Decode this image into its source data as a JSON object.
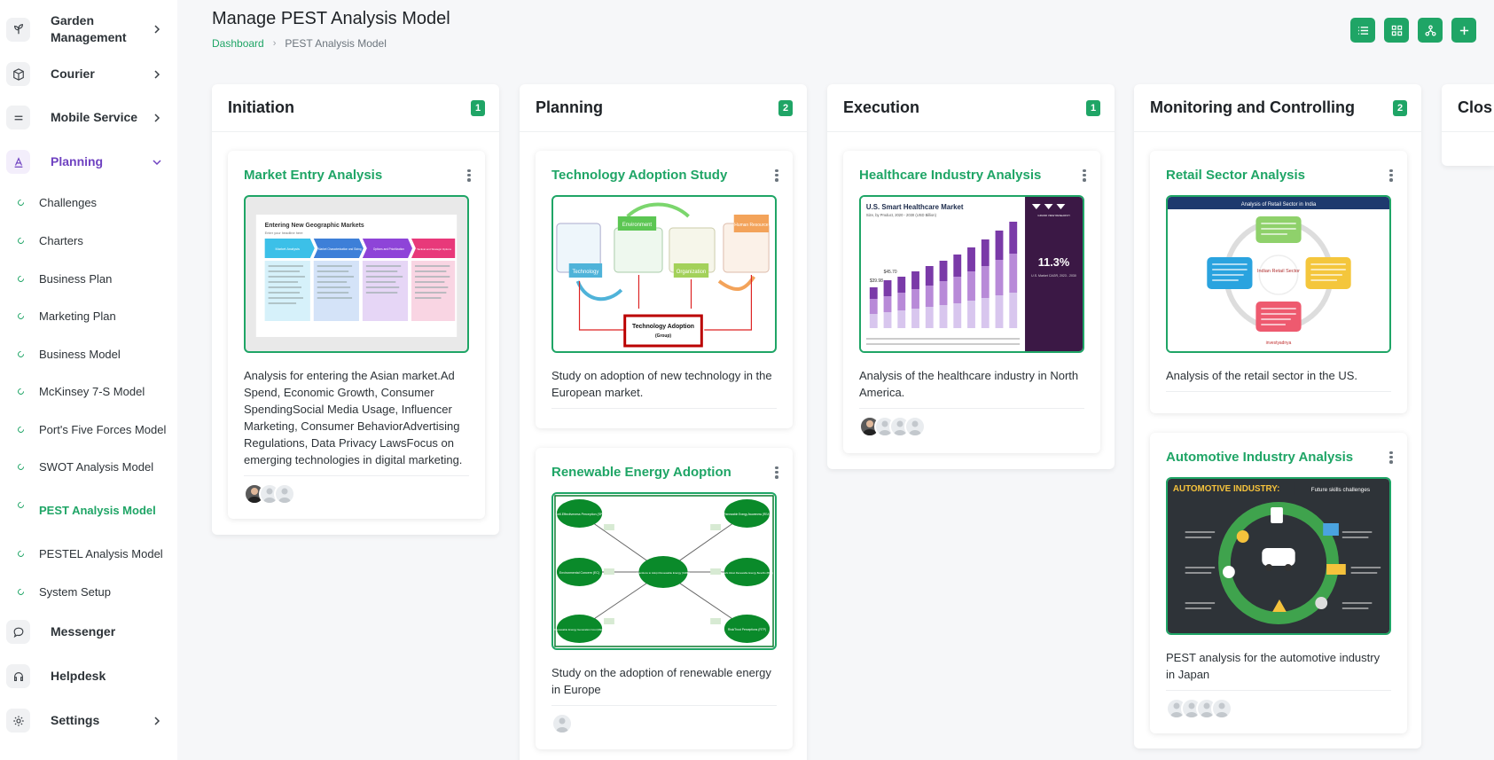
{
  "sidebar": {
    "items": [
      {
        "label": "Garden Management",
        "icon": "plant-icon"
      },
      {
        "label": "Courier",
        "icon": "box-icon"
      },
      {
        "label": "Mobile Service",
        "icon": "menu-icon"
      },
      {
        "label": "Planning",
        "icon": "planning-icon"
      },
      {
        "label": "Messenger",
        "icon": "chat-icon"
      },
      {
        "label": "Helpdesk",
        "icon": "headset-icon"
      },
      {
        "label": "Settings",
        "icon": "gear-icon"
      }
    ],
    "sub_items": [
      "Challenges",
      "Charters",
      "Business Plan",
      "Marketing Plan",
      "Business Model",
      "McKinsey 7-S Model",
      "Port's Five Forces Model",
      "SWOT Analysis Model",
      "PEST Analysis Model",
      "PESTEL Analysis Model",
      "System Setup"
    ]
  },
  "header": {
    "title": "Manage PEST Analysis Model",
    "breadcrumb": {
      "home": "Dashboard",
      "current": "PEST Analysis Model"
    },
    "toolbar": [
      "list-icon",
      "grid-icon",
      "hierarchy-icon",
      "plus-icon"
    ]
  },
  "colors": {
    "accent": "#1fa566",
    "planning_active": "#6f42c1"
  },
  "columns": [
    {
      "title": "Initiation",
      "count": "1"
    },
    {
      "title": "Planning",
      "count": "2"
    },
    {
      "title": "Execution",
      "count": "1"
    },
    {
      "title": "Monitoring and Controlling",
      "count": "2"
    },
    {
      "title": "Clos",
      "count": ""
    }
  ],
  "cards": [
    {
      "title": "Market Entry Analysis",
      "desc": "Analysis for entering the Asian market.Ad Spend, Economic Growth, Consumer SpendingSocial Media Usage, Influencer Marketing, Consumer BehaviorAdvertising Regulations, Data Privacy LawsFocus on emerging technologies in digital marketing.",
      "thumb": {
        "title": "Entering New Geographic Markets",
        "subtitle": "Enter your headline here",
        "sections": [
          "Market Analysis",
          "Market Characterization and Sizing",
          "Options and Prioritization",
          "Tactical and Strategic Options"
        ]
      }
    },
    {
      "title": "Technology Adoption Study",
      "desc": "Study on adoption of new technology in the European market.",
      "thumb": {
        "nodes": [
          "Technology",
          "Environment",
          "Organization",
          "Human Resource"
        ],
        "center": "Technology Adoption",
        "center_sub": "(Group)"
      }
    },
    {
      "title": "Renewable Energy Adoption",
      "desc": "Study on the adoption of renewable energy in Europe",
      "thumb": {
        "nodes": [
          "Self-Effectiveness Perception (SP)",
          "Environmental Concern (EC)",
          "Renewable Energy Generation Cost (REC)",
          "Renewable Energy Awareness (REA)",
          "Beliefs About Renewable Energy Benefits (BRE)",
          "Risk/Trust Perceptions (RTP)"
        ],
        "center": "Intentions to Adopt Renewable Energy (IARE)"
      }
    },
    {
      "title": "Healthcare Industry Analysis",
      "desc": "Analysis of the healthcare industry in North America.",
      "thumb": {
        "title": "U.S. Smart Healthcare Market",
        "subtitle": "Size, by Product, 2020 - 2030 (USD Billion)",
        "cagr": "11.3%",
        "cagr_label": "U.S. Market CAGR, 2023 - 2030",
        "v1": "$39.98",
        "v2": "$45.70",
        "brand": "GRAND VIEW RESEARCH"
      }
    },
    {
      "title": "Retail Sector Analysis",
      "desc": "Analysis of the retail sector in the US.",
      "thumb": {
        "title": "Analysis of Retail Sector in India",
        "center": "Indian Retail Sector",
        "brand": "investyadnya"
      }
    },
    {
      "title": "Automotive Industry Analysis",
      "desc": "PEST analysis for the automotive industry in Japan",
      "thumb": {
        "title": "AUTOMOTIVE INDUSTRY:",
        "subtitle": "Future skills challenges"
      }
    }
  ]
}
